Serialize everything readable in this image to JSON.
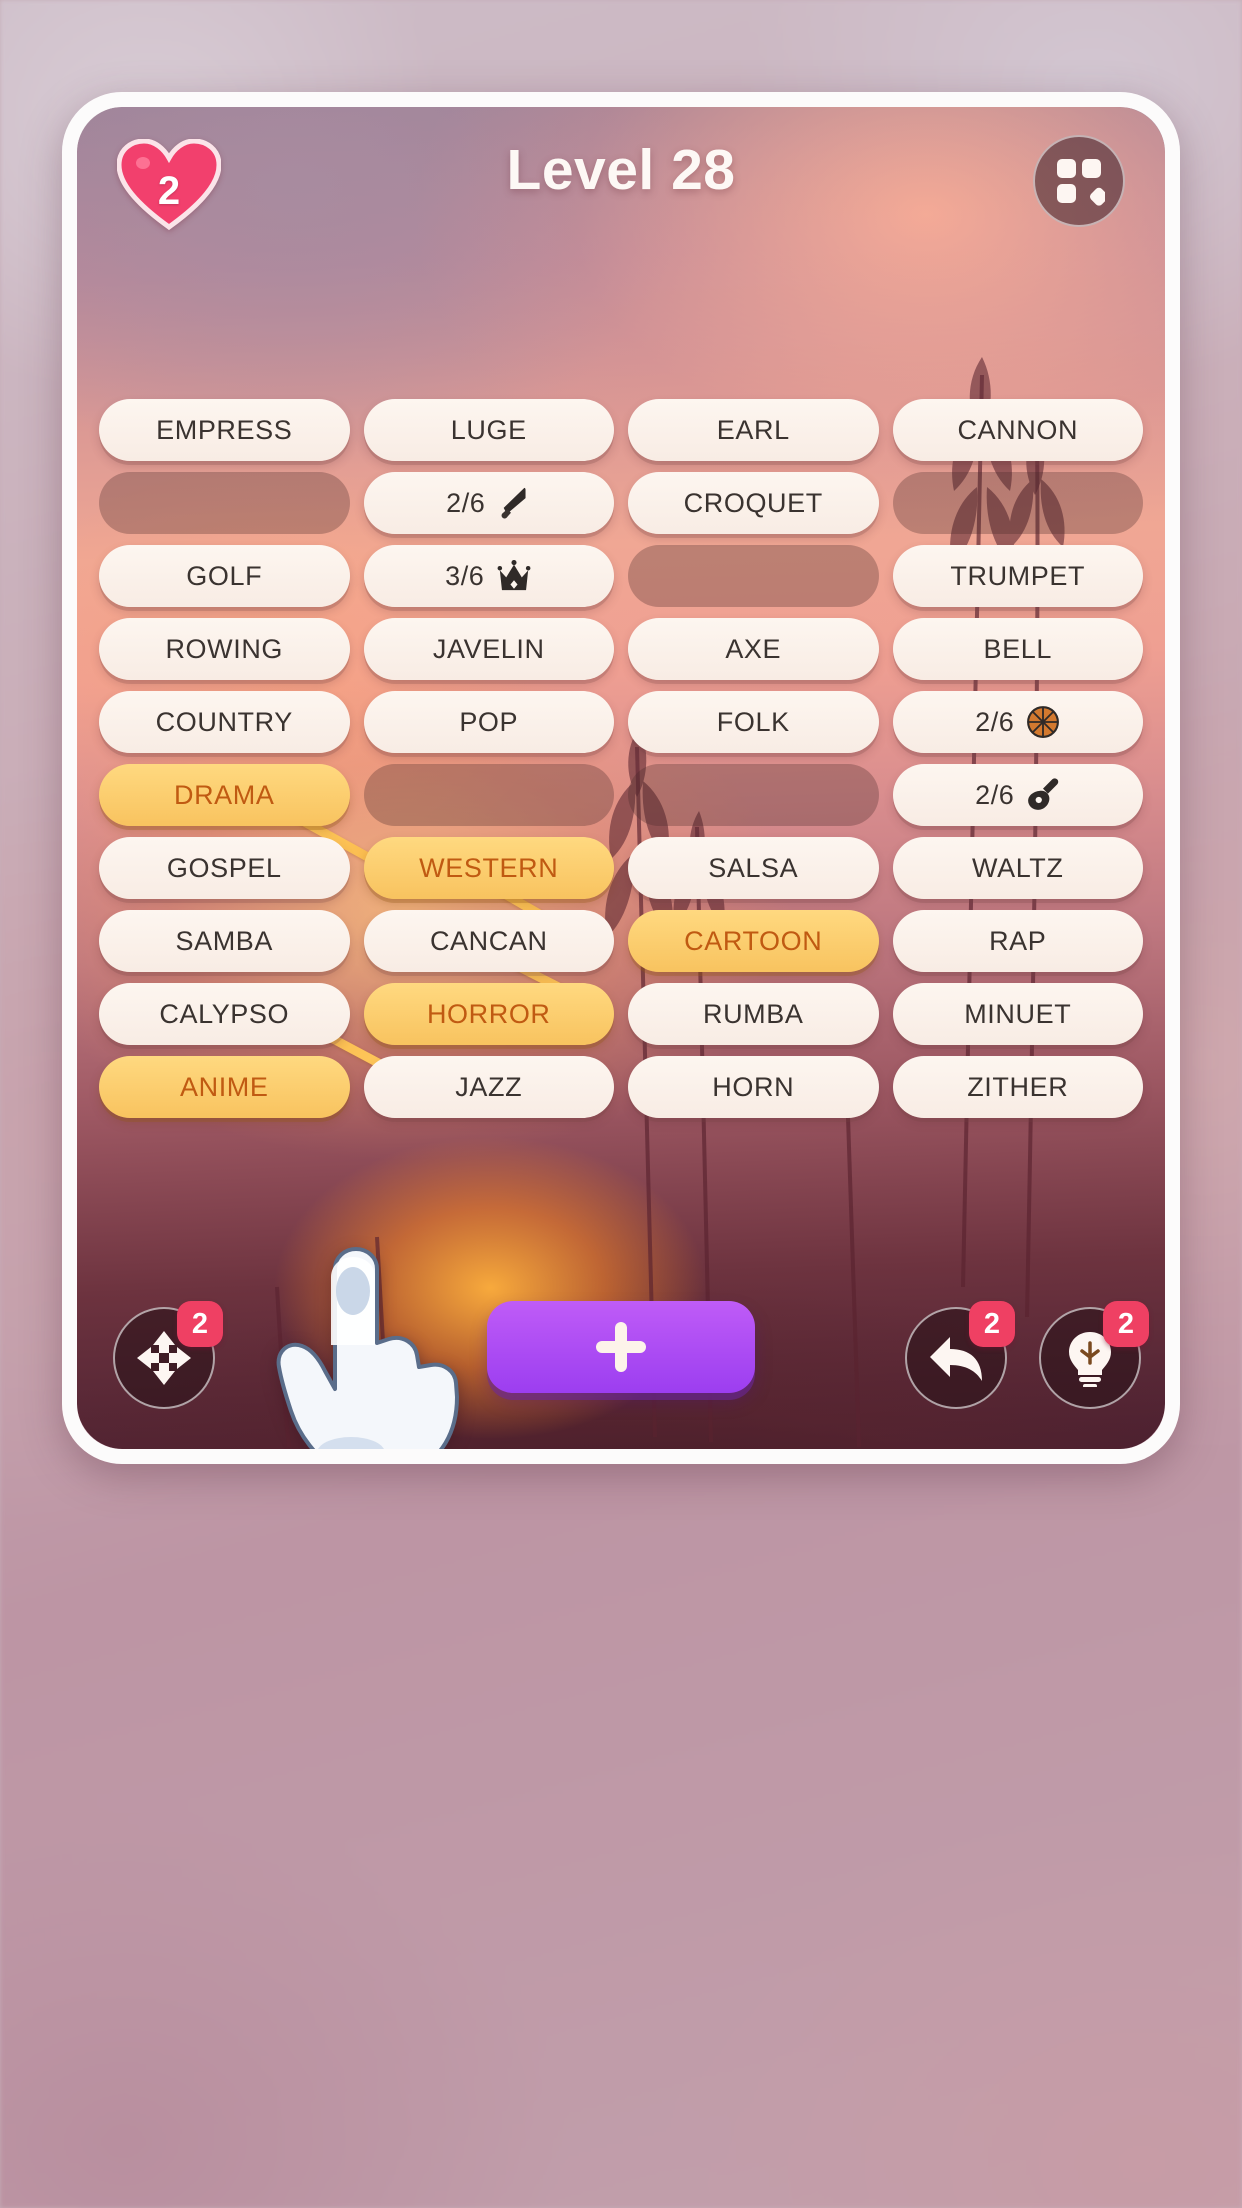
{
  "header": {
    "hearts_count": "2",
    "level_title": "Level 28",
    "heart_icon": "heart-icon",
    "menu_icon": "grid-menu-icon"
  },
  "colors": {
    "tile_bg": "#fdf6f0",
    "tile_selected_bg": "#ffd980",
    "tile_selected_text": "#c05a12",
    "tile_empty": "rgba(70,40,40,0.30)",
    "badge": "#ef4063",
    "add_button": "#9c3ef0",
    "connector": "#ffca5e"
  },
  "grid": {
    "rows": [
      [
        {
          "label": "EMPRESS",
          "state": "normal",
          "icon": ""
        },
        {
          "label": "LUGE",
          "state": "normal",
          "icon": ""
        },
        {
          "label": "EARL",
          "state": "normal",
          "icon": ""
        },
        {
          "label": "CANNON",
          "state": "normal",
          "icon": ""
        }
      ],
      [
        {
          "label": "",
          "state": "empty",
          "icon": ""
        },
        {
          "label": "2/6",
          "state": "counter",
          "icon": "knife-icon"
        },
        {
          "label": "CROQUET",
          "state": "normal",
          "icon": ""
        },
        {
          "label": "",
          "state": "empty",
          "icon": ""
        }
      ],
      [
        {
          "label": "GOLF",
          "state": "normal",
          "icon": ""
        },
        {
          "label": "3/6",
          "state": "counter",
          "icon": "crown-icon"
        },
        {
          "label": "",
          "state": "empty",
          "icon": ""
        },
        {
          "label": "TRUMPET",
          "state": "normal",
          "icon": ""
        }
      ],
      [
        {
          "label": "ROWING",
          "state": "normal",
          "icon": ""
        },
        {
          "label": "JAVELIN",
          "state": "normal",
          "icon": ""
        },
        {
          "label": "AXE",
          "state": "normal",
          "icon": ""
        },
        {
          "label": "BELL",
          "state": "normal",
          "icon": ""
        }
      ],
      [
        {
          "label": "COUNTRY",
          "state": "normal",
          "icon": ""
        },
        {
          "label": "POP",
          "state": "normal",
          "icon": ""
        },
        {
          "label": "FOLK",
          "state": "normal",
          "icon": ""
        },
        {
          "label": "2/6",
          "state": "counter",
          "icon": "basketball-icon"
        }
      ],
      [
        {
          "label": "DRAMA",
          "state": "selected",
          "icon": ""
        },
        {
          "label": "",
          "state": "empty",
          "icon": ""
        },
        {
          "label": "",
          "state": "empty",
          "icon": ""
        },
        {
          "label": "2/6",
          "state": "counter",
          "icon": "guitar-icon"
        }
      ],
      [
        {
          "label": "GOSPEL",
          "state": "normal",
          "icon": ""
        },
        {
          "label": "WESTERN",
          "state": "selected",
          "icon": ""
        },
        {
          "label": "SALSA",
          "state": "normal",
          "icon": ""
        },
        {
          "label": "WALTZ",
          "state": "normal",
          "icon": ""
        }
      ],
      [
        {
          "label": "SAMBA",
          "state": "normal",
          "icon": ""
        },
        {
          "label": "CANCAN",
          "state": "normal",
          "icon": ""
        },
        {
          "label": "CARTOON",
          "state": "selected",
          "icon": ""
        },
        {
          "label": "RAP",
          "state": "normal",
          "icon": ""
        }
      ],
      [
        {
          "label": "CALYPSO",
          "state": "normal",
          "icon": ""
        },
        {
          "label": "HORROR",
          "state": "selected",
          "icon": ""
        },
        {
          "label": "RUMBA",
          "state": "normal",
          "icon": ""
        },
        {
          "label": "MINUET",
          "state": "normal",
          "icon": ""
        }
      ],
      [
        {
          "label": "ANIME",
          "state": "selected",
          "icon": ""
        },
        {
          "label": "JAZZ",
          "state": "normal",
          "icon": ""
        },
        {
          "label": "HORN",
          "state": "normal",
          "icon": ""
        },
        {
          "label": "ZITHER",
          "state": "normal",
          "icon": ""
        }
      ]
    ]
  },
  "toolbar": {
    "shuffle": {
      "icon": "move-arrows-icon",
      "badge": "2"
    },
    "add": {
      "icon": "plus-icon"
    },
    "undo": {
      "icon": "undo-arrow-icon",
      "badge": "2"
    },
    "hint": {
      "icon": "lightbulb-icon",
      "badge": "2"
    }
  }
}
